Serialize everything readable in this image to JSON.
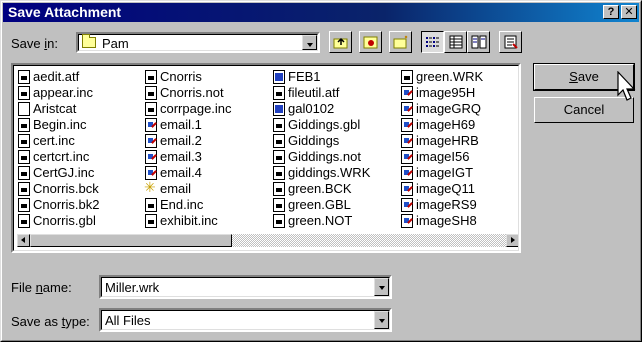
{
  "window": {
    "title": "Save Attachment",
    "help_label": "?",
    "close_label": "✕"
  },
  "save_in": {
    "label_prefix": "Save ",
    "label_underline": "i",
    "label_suffix": "n:",
    "value": "Pam"
  },
  "toolbar": {
    "icons": [
      "up-one-level-icon",
      "desktop-icon",
      "create-new-folder-icon",
      "list-view-icon",
      "details-view-icon",
      "properties-view-icon",
      "commands-icon"
    ]
  },
  "files": {
    "columns": [
      [
        {
          "name": "aedit.atf",
          "icon": "doc"
        },
        {
          "name": "appear.inc",
          "icon": "doc"
        },
        {
          "name": "Aristcat",
          "icon": "blank"
        },
        {
          "name": "Begin.inc",
          "icon": "doc"
        },
        {
          "name": "cert.inc",
          "icon": "doc"
        },
        {
          "name": "certcrt.inc",
          "icon": "doc"
        },
        {
          "name": "CertGJ.inc",
          "icon": "doc"
        },
        {
          "name": "Cnorris.bck",
          "icon": "doc"
        },
        {
          "name": "Cnorris.bk2",
          "icon": "doc"
        },
        {
          "name": "Cnorris.gbl",
          "icon": "doc"
        }
      ],
      [
        {
          "name": "Cnorris",
          "icon": "doc"
        },
        {
          "name": "Cnorris.not",
          "icon": "doc"
        },
        {
          "name": "corrpage.inc",
          "icon": "doc"
        },
        {
          "name": "email.1",
          "icon": "img"
        },
        {
          "name": "email.2",
          "icon": "img"
        },
        {
          "name": "email.3",
          "icon": "img"
        },
        {
          "name": "email.4",
          "icon": "img"
        },
        {
          "name": "email",
          "icon": "star"
        },
        {
          "name": "End.inc",
          "icon": "doc"
        },
        {
          "name": "exhibit.inc",
          "icon": "doc"
        }
      ],
      [
        {
          "name": "FEB1",
          "icon": "blue"
        },
        {
          "name": "fileutil.atf",
          "icon": "doc"
        },
        {
          "name": "gal0102",
          "icon": "blue"
        },
        {
          "name": "Giddings.gbl",
          "icon": "doc"
        },
        {
          "name": "Giddings",
          "icon": "doc"
        },
        {
          "name": "Giddings.not",
          "icon": "doc"
        },
        {
          "name": "giddings.WRK",
          "icon": "doc"
        },
        {
          "name": "green.BCK",
          "icon": "doc"
        },
        {
          "name": "green.GBL",
          "icon": "doc"
        },
        {
          "name": "green.NOT",
          "icon": "doc"
        }
      ],
      [
        {
          "name": "green.WRK",
          "icon": "doc"
        },
        {
          "name": "image95H",
          "icon": "img"
        },
        {
          "name": "imageGRQ",
          "icon": "img"
        },
        {
          "name": "imageH69",
          "icon": "img"
        },
        {
          "name": "imageHRB",
          "icon": "img"
        },
        {
          "name": "imageI56",
          "icon": "img"
        },
        {
          "name": "imageIGT",
          "icon": "img"
        },
        {
          "name": "imageQ11",
          "icon": "img"
        },
        {
          "name": "imageRS9",
          "icon": "img"
        },
        {
          "name": "imageSH8",
          "icon": "img"
        }
      ]
    ]
  },
  "file_name": {
    "label_prefix": "File ",
    "label_underline": "n",
    "label_suffix": "ame:",
    "value": "Miller.wrk"
  },
  "save_as_type": {
    "label_prefix": "Save as ",
    "label_underline": "t",
    "label_suffix": "ype:",
    "value": "All Files"
  },
  "buttons": {
    "save_underline": "S",
    "save_rest": "ave",
    "cancel": "Cancel"
  }
}
